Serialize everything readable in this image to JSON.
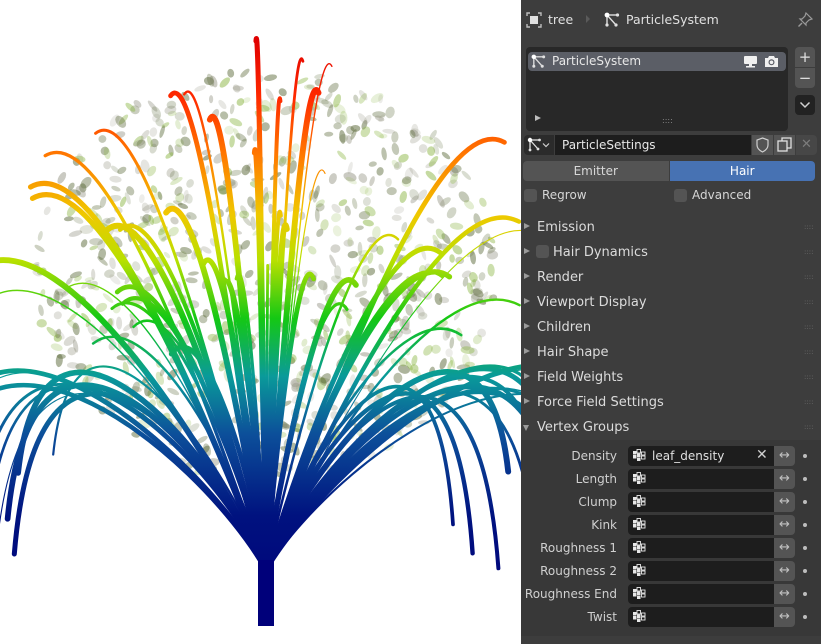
{
  "viewport": {
    "subject": "tree",
    "description": "Particle hair tree rendered with weight gradient colors (blue at trunk to red at tips) with leaf particles"
  },
  "header": {
    "object_icon": "object-icon",
    "object_name": "tree",
    "separator_icon": "breadcrumb-arrow-icon",
    "particle_icon": "particle-system-icon",
    "particle_system_name": "ParticleSystem",
    "pin_icon": "pin-icon"
  },
  "particle_list": {
    "items": [
      {
        "icon": "particle-system-icon",
        "label": "ParticleSystem",
        "viewport_icon": "monitor-icon",
        "render_icon": "camera-icon"
      }
    ],
    "add_label": "+",
    "remove_label": "−",
    "menu_icon": "chevron-down-icon",
    "expand_icon": "triangle-right-icon",
    "grip": "::::"
  },
  "settings": {
    "name": "ParticleSettings",
    "type_icon": "particle-settings-icon",
    "fake_user_icon": "shield-icon",
    "copy_icon": "duplicate-icon",
    "unlink_label": "✕"
  },
  "type_toggle": {
    "options": [
      "Emitter",
      "Hair"
    ],
    "selected": "Hair"
  },
  "options": {
    "regrow": {
      "label": "Regrow",
      "checked": false
    },
    "advanced": {
      "label": "Advanced",
      "checked": false
    }
  },
  "panels": [
    {
      "label": "Emission",
      "expanded": false,
      "has_checkbox": false
    },
    {
      "label": "Hair Dynamics",
      "expanded": false,
      "has_checkbox": true,
      "checked": false
    },
    {
      "label": "Render",
      "expanded": false,
      "has_checkbox": false
    },
    {
      "label": "Viewport Display",
      "expanded": false,
      "has_checkbox": false
    },
    {
      "label": "Children",
      "expanded": false,
      "has_checkbox": false
    },
    {
      "label": "Hair Shape",
      "expanded": false,
      "has_checkbox": false
    },
    {
      "label": "Field Weights",
      "expanded": false,
      "has_checkbox": false
    },
    {
      "label": "Force Field Settings",
      "expanded": false,
      "has_checkbox": false
    },
    {
      "label": "Vertex Groups",
      "expanded": true,
      "has_checkbox": false
    }
  ],
  "vertex_groups": {
    "rows": [
      {
        "label": "Density",
        "value": "leaf_density",
        "clear": "✕"
      },
      {
        "label": "Length",
        "value": ""
      },
      {
        "label": "Clump",
        "value": ""
      },
      {
        "label": "Kink",
        "value": ""
      },
      {
        "label": "Roughness 1",
        "value": ""
      },
      {
        "label": "Roughness 2",
        "value": ""
      },
      {
        "label": "Roughness End",
        "value": ""
      },
      {
        "label": "Twist",
        "value": ""
      }
    ],
    "invert_label": "↔",
    "group_icon": "vertex-group-icon"
  },
  "colors": {
    "panel_bg": "#3d3d3d",
    "accent": "#4772b3",
    "field_bg": "#1d1d1d",
    "button_bg": "#545454"
  }
}
